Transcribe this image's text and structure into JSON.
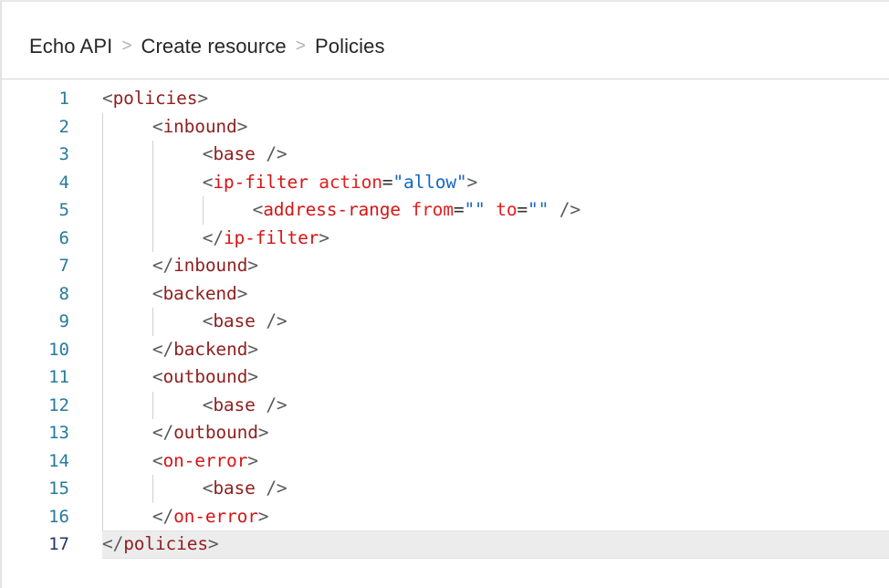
{
  "breadcrumb": {
    "separator": ">",
    "items": [
      {
        "label": "Echo API"
      },
      {
        "label": "Create resource"
      },
      {
        "label": "Policies"
      }
    ]
  },
  "editor": {
    "language": "xml",
    "active_line": 17,
    "colors": {
      "line_number": "#277a9c",
      "active_line_number": "#1f3864",
      "active_line_background": "#ececec",
      "tag": "#8f1f1f",
      "tag_hyphenated": "#d41515",
      "attribute_name": "#e22020",
      "attribute_value": "#1565c8",
      "bracket": "#5a5a5a",
      "indent_guide": "#d0d0d0",
      "background": "#ffffff"
    },
    "lines": [
      {
        "num": "1",
        "indent": 0,
        "text": "<policies>"
      },
      {
        "num": "2",
        "indent": 1,
        "text": "<inbound>"
      },
      {
        "num": "3",
        "indent": 2,
        "text": "<base />"
      },
      {
        "num": "4",
        "indent": 2,
        "text": "<ip-filter action=\"allow\">"
      },
      {
        "num": "5",
        "indent": 3,
        "text": "<address-range from=\"\" to=\"\" />"
      },
      {
        "num": "6",
        "indent": 2,
        "text": "</ip-filter>"
      },
      {
        "num": "7",
        "indent": 1,
        "text": "</inbound>"
      },
      {
        "num": "8",
        "indent": 1,
        "text": "<backend>"
      },
      {
        "num": "9",
        "indent": 2,
        "text": "<base />"
      },
      {
        "num": "10",
        "indent": 1,
        "text": "</backend>"
      },
      {
        "num": "11",
        "indent": 1,
        "text": "<outbound>"
      },
      {
        "num": "12",
        "indent": 2,
        "text": "<base />"
      },
      {
        "num": "13",
        "indent": 1,
        "text": "</outbound>"
      },
      {
        "num": "14",
        "indent": 1,
        "text": "<on-error>"
      },
      {
        "num": "15",
        "indent": 2,
        "text": "<base />"
      },
      {
        "num": "16",
        "indent": 1,
        "text": "</on-error>"
      },
      {
        "num": "17",
        "indent": 0,
        "text": "</policies>"
      }
    ]
  }
}
